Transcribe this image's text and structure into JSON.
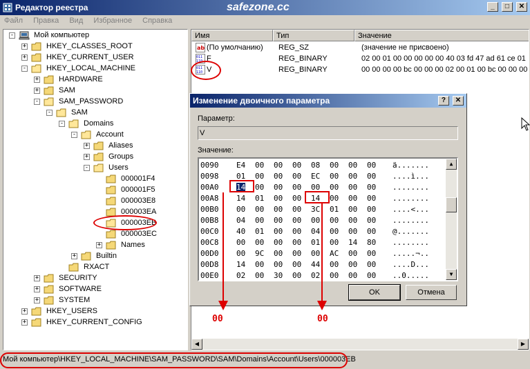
{
  "window": {
    "title": "Редактор реестра",
    "watermark": "safezone.cc",
    "buttons": {
      "minimize": "_",
      "maximize": "□",
      "close": "✕"
    }
  },
  "menu": [
    "Файл",
    "Правка",
    "Вид",
    "Избранное",
    "Справка"
  ],
  "tree": [
    {
      "label": "Мой компьютер",
      "level": 0,
      "expander": "-"
    },
    {
      "label": "HKEY_CLASSES_ROOT",
      "level": 1,
      "expander": "+"
    },
    {
      "label": "HKEY_CURRENT_USER",
      "level": 1,
      "expander": "+"
    },
    {
      "label": "HKEY_LOCAL_MACHINE",
      "level": 1,
      "expander": "-"
    },
    {
      "label": "HARDWARE",
      "level": 2,
      "expander": "+"
    },
    {
      "label": "SAM",
      "level": 2,
      "expander": "+"
    },
    {
      "label": "SAM_PASSWORD",
      "level": 2,
      "expander": "-"
    },
    {
      "label": "SAM",
      "level": 3,
      "expander": "-"
    },
    {
      "label": "Domains",
      "level": 4,
      "expander": "-"
    },
    {
      "label": "Account",
      "level": 5,
      "expander": "-"
    },
    {
      "label": "Aliases",
      "level": 6,
      "expander": "+"
    },
    {
      "label": "Groups",
      "level": 6,
      "expander": "+"
    },
    {
      "label": "Users",
      "level": 6,
      "expander": "-"
    },
    {
      "label": "000001F4",
      "level": 7,
      "expander": ""
    },
    {
      "label": "000001F5",
      "level": 7,
      "expander": ""
    },
    {
      "label": "000003E8",
      "level": 7,
      "expander": ""
    },
    {
      "label": "000003EA",
      "level": 7,
      "expander": ""
    },
    {
      "label": "000003EB",
      "level": 7,
      "expander": "",
      "selected": true
    },
    {
      "label": "000003EC",
      "level": 7,
      "expander": ""
    },
    {
      "label": "Names",
      "level": 7,
      "expander": "+"
    },
    {
      "label": "Builtin",
      "level": 5,
      "expander": "+"
    },
    {
      "label": "RXACT",
      "level": 4,
      "expander": ""
    },
    {
      "label": "SECURITY",
      "level": 2,
      "expander": "+"
    },
    {
      "label": "SOFTWARE",
      "level": 2,
      "expander": "+"
    },
    {
      "label": "SYSTEM",
      "level": 2,
      "expander": "+"
    },
    {
      "label": "HKEY_USERS",
      "level": 1,
      "expander": "+"
    },
    {
      "label": "HKEY_CURRENT_CONFIG",
      "level": 1,
      "expander": "+"
    }
  ],
  "list": {
    "headers": {
      "name": "Имя",
      "type": "Тип",
      "value": "Значение"
    },
    "rows": [
      {
        "icon": "string-value-icon",
        "name": "(По умолчанию)",
        "type": "REG_SZ",
        "value": "(значение не присвоено)"
      },
      {
        "icon": "binary-value-icon",
        "name": "F",
        "type": "REG_BINARY",
        "value": "02 00 01 00 00 00 00 00 40 03 fd 47 ad 61 ce 01"
      },
      {
        "icon": "binary-value-icon",
        "name": "V",
        "type": "REG_BINARY",
        "value": "00 00 00 00 bc 00 00 00 02 00 01 00 bc 00 00 00"
      }
    ]
  },
  "dialog": {
    "title": "Изменение двоичного параметра",
    "param_label": "Параметр:",
    "param_value": "V",
    "value_label": "Значение:",
    "ok": "OK",
    "cancel": "Отмена",
    "help": "?",
    "close": "✕",
    "hex_rows": [
      {
        "addr": "0090",
        "bytes": [
          "E4",
          "00",
          "00",
          "00",
          "08",
          "00",
          "00",
          "00"
        ],
        "ascii": "ä......."
      },
      {
        "addr": "0098",
        "bytes": [
          "01",
          "00",
          "00",
          "00",
          "EC",
          "00",
          "00",
          "00"
        ],
        "ascii": "....ì..."
      },
      {
        "addr": "00A0",
        "bytes": [
          "14",
          "00",
          "00",
          "00",
          "00",
          "00",
          "00",
          "00"
        ],
        "ascii": "........",
        "selected_byte": 0
      },
      {
        "addr": "00A8",
        "bytes": [
          "14",
          "01",
          "00",
          "00",
          "14",
          "00",
          "00",
          "00"
        ],
        "ascii": "........"
      },
      {
        "addr": "00B0",
        "bytes": [
          "00",
          "00",
          "00",
          "00",
          "3C",
          "01",
          "00",
          "00"
        ],
        "ascii": "....<..."
      },
      {
        "addr": "00B8",
        "bytes": [
          "04",
          "00",
          "00",
          "00",
          "00",
          "00",
          "00",
          "00"
        ],
        "ascii": "........"
      },
      {
        "addr": "00C0",
        "bytes": [
          "40",
          "01",
          "00",
          "00",
          "04",
          "00",
          "00",
          "00"
        ],
        "ascii": "@......."
      },
      {
        "addr": "00C8",
        "bytes": [
          "00",
          "00",
          "00",
          "00",
          "01",
          "00",
          "14",
          "80"
        ],
        "ascii": "........"
      },
      {
        "addr": "00D0",
        "bytes": [
          "00",
          "9C",
          "00",
          "00",
          "00",
          "AC",
          "00",
          "00"
        ],
        "ascii": ".....¬.."
      },
      {
        "addr": "00D8",
        "bytes": [
          "14",
          "00",
          "00",
          "00",
          "44",
          "00",
          "00",
          "00"
        ],
        "ascii": "....D..."
      },
      {
        "addr": "00E0",
        "bytes": [
          "02",
          "00",
          "30",
          "00",
          "02",
          "00",
          "00",
          "00"
        ],
        "ascii": "..0....."
      }
    ]
  },
  "annotations": {
    "left_label": "00",
    "right_label": "00",
    "color": "#dd0000"
  },
  "status": "Мой компьютер\\HKEY_LOCAL_MACHINE\\SAM_PASSWORD\\SAM\\Domains\\Account\\Users\\000003EB"
}
